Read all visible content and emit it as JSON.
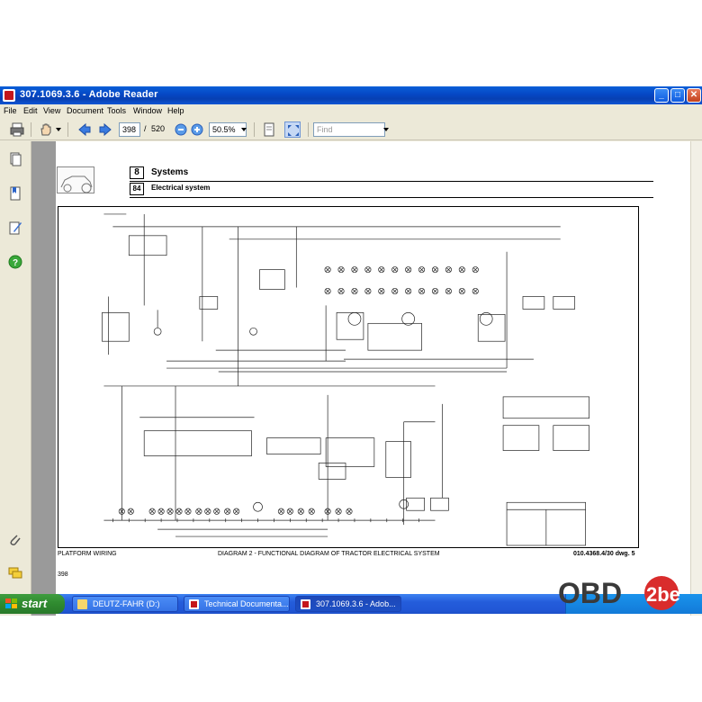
{
  "window": {
    "title": "307.1069.3.6  - Adobe Reader",
    "controls": {
      "minimize": "_",
      "maximize": "□",
      "close": "✕"
    }
  },
  "menu": [
    "File",
    "Edit",
    "View",
    "Document",
    "Tools",
    "Window",
    "Help"
  ],
  "toolbar": {
    "current_page": "398",
    "page_separator": "/",
    "total_pages": "520",
    "zoom": "50.5%",
    "find_placeholder": "Find"
  },
  "page": {
    "chapter_num": "8",
    "chapter_title": "Systems",
    "section_num": "84",
    "section_title": "Electrical system",
    "footer_left": "PLATFORM WIRING",
    "footer_center": "DIAGRAM 2 - FUNCTIONAL DIAGRAM OF TRACTOR ELECTRICAL SYSTEM",
    "footer_right": "010.4368.4/30  dwg. 5",
    "page_number": "398"
  },
  "taskbar": {
    "start_label": "start",
    "tasks": [
      {
        "label": "DEUTZ-FAHR (D:)",
        "icon": "folder-icon",
        "active": false
      },
      {
        "label": "Technical Documenta...",
        "icon": "pdf-icon",
        "active": false
      },
      {
        "label": "307.1069.3.6 - Adob...",
        "icon": "pdf-icon",
        "active": true
      }
    ]
  },
  "watermark": {
    "text_a": "OBD",
    "text_b": "2be"
  },
  "colors": {
    "titlebar": "#0a5fd8",
    "taskbar": "#245ddb",
    "start": "#2f8a2f",
    "document_bg": "#9a9a9a",
    "accent_red": "#c4161c"
  }
}
